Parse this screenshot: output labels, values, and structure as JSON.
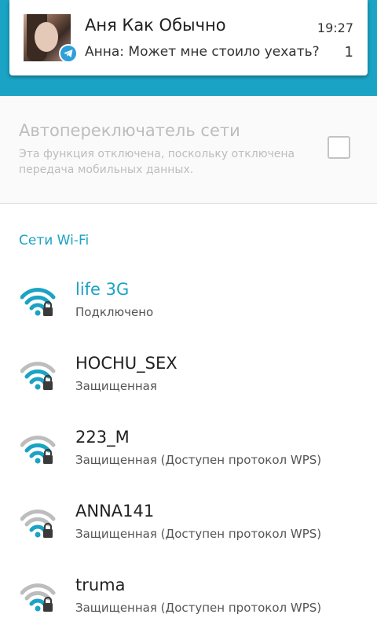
{
  "notification": {
    "sender": "Аня Как Обычно",
    "time": "19:27",
    "message": "Анна: Может мне стоило уехать?",
    "count": "1",
    "badge_icon": "telegram-icon"
  },
  "network_switcher": {
    "title": "Автопереключатель сети",
    "description": "Эта функция отключена, поскольку отключена передача мобильных данных.",
    "checked": false
  },
  "wifi_section": {
    "header": "Сети Wi-Fi",
    "networks": [
      {
        "name": "life 3G",
        "status": "Подключено",
        "signal": 4,
        "locked": true,
        "connected": true
      },
      {
        "name": "HOCHU_SEX",
        "status": "Защищенная",
        "signal": 3,
        "locked": true,
        "connected": false
      },
      {
        "name": "223_M",
        "status": "Защищенная (Доступен протокол WPS)",
        "signal": 3,
        "locked": true,
        "connected": false
      },
      {
        "name": "ANNA141",
        "status": "Защищенная (Доступен протокол WPS)",
        "signal": 2,
        "locked": true,
        "connected": false
      },
      {
        "name": "truma",
        "status": "Защищенная (Доступен протокол WPS)",
        "signal": 2,
        "locked": true,
        "connected": false
      }
    ]
  },
  "colors": {
    "accent": "#1aa3c4",
    "wifi_active": "#1aa3c4",
    "wifi_inactive": "#bdbdbd",
    "lock": "#3a3a3a"
  }
}
